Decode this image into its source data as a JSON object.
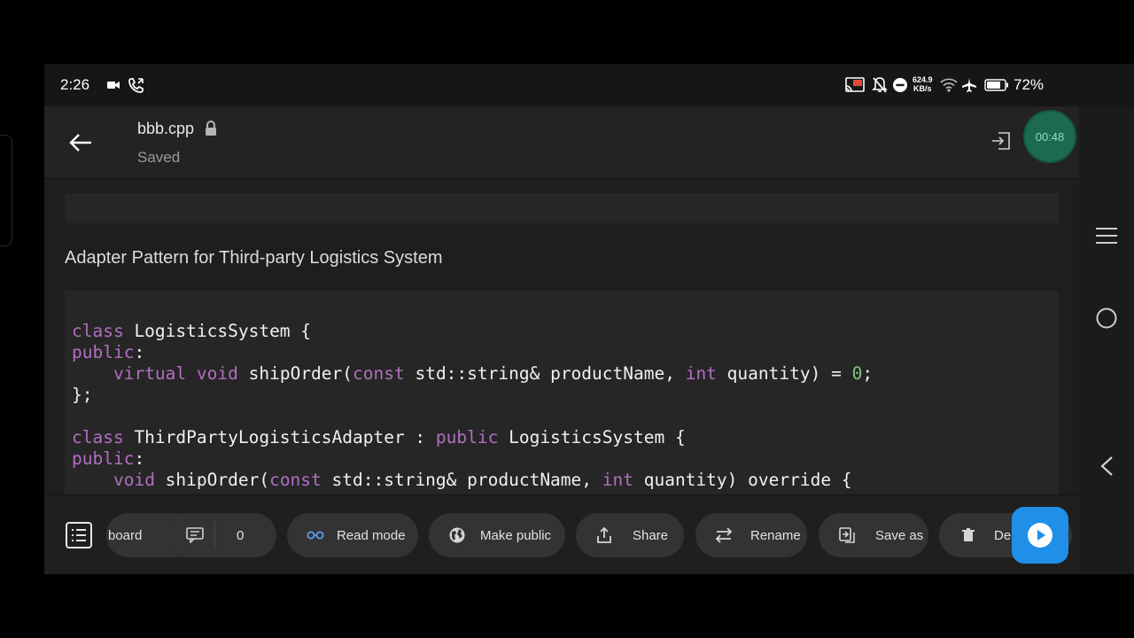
{
  "status_bar": {
    "time": "2:26",
    "net_speed_value": "624.9",
    "net_speed_unit": "KB/s",
    "battery": "72%",
    "icons": [
      "video-icon",
      "phone-call-icon",
      "cast-icon",
      "mute-icon",
      "dnd-icon",
      "wifi-icon",
      "airplane-icon",
      "battery-icon"
    ]
  },
  "app_bar": {
    "file_name": "bbb.cpp",
    "status": "Saved",
    "timer": "00:48"
  },
  "content": {
    "heading": "Adapter Pattern for Third-party Logistics System",
    "code_lines": [
      [
        {
          "t": "class",
          "k": "kw"
        },
        {
          "t": " LogisticsSystem {"
        }
      ],
      [
        {
          "t": "public",
          "k": "kw"
        },
        {
          "t": ":"
        }
      ],
      [
        {
          "t": "    "
        },
        {
          "t": "virtual",
          "k": "kw"
        },
        {
          "t": " "
        },
        {
          "t": "void",
          "k": "kw"
        },
        {
          "t": " shipOrder("
        },
        {
          "t": "const",
          "k": "kw"
        },
        {
          "t": " std::string& productName, "
        },
        {
          "t": "int",
          "k": "kw"
        },
        {
          "t": " quantity) = "
        },
        {
          "t": "0",
          "k": "num"
        },
        {
          "t": ";"
        }
      ],
      [
        {
          "t": "};"
        }
      ],
      [
        {
          "t": ""
        }
      ],
      [
        {
          "t": "class",
          "k": "kw"
        },
        {
          "t": " ThirdPartyLogisticsAdapter : "
        },
        {
          "t": "public",
          "k": "kw"
        },
        {
          "t": " LogisticsSystem {"
        }
      ],
      [
        {
          "t": "public",
          "k": "kw"
        },
        {
          "t": ":"
        }
      ],
      [
        {
          "t": "    "
        },
        {
          "t": "void",
          "k": "kw"
        },
        {
          "t": " shipOrder("
        },
        {
          "t": "const",
          "k": "kw"
        },
        {
          "t": " std::string& productName, "
        },
        {
          "t": "int",
          "k": "kw"
        },
        {
          "t": " quantity) override {"
        }
      ]
    ]
  },
  "toolbar": {
    "board_label": "board",
    "comment_count": "0",
    "read_mode": "Read mode",
    "make_public": "Make public",
    "share": "Share",
    "rename": "Rename",
    "save_as": "Save as",
    "delete": "De"
  },
  "colors": {
    "keyword": "#b26ec0",
    "number": "#83c27c",
    "accent": "#1f8fe8",
    "timer": "#1c6b4f"
  }
}
